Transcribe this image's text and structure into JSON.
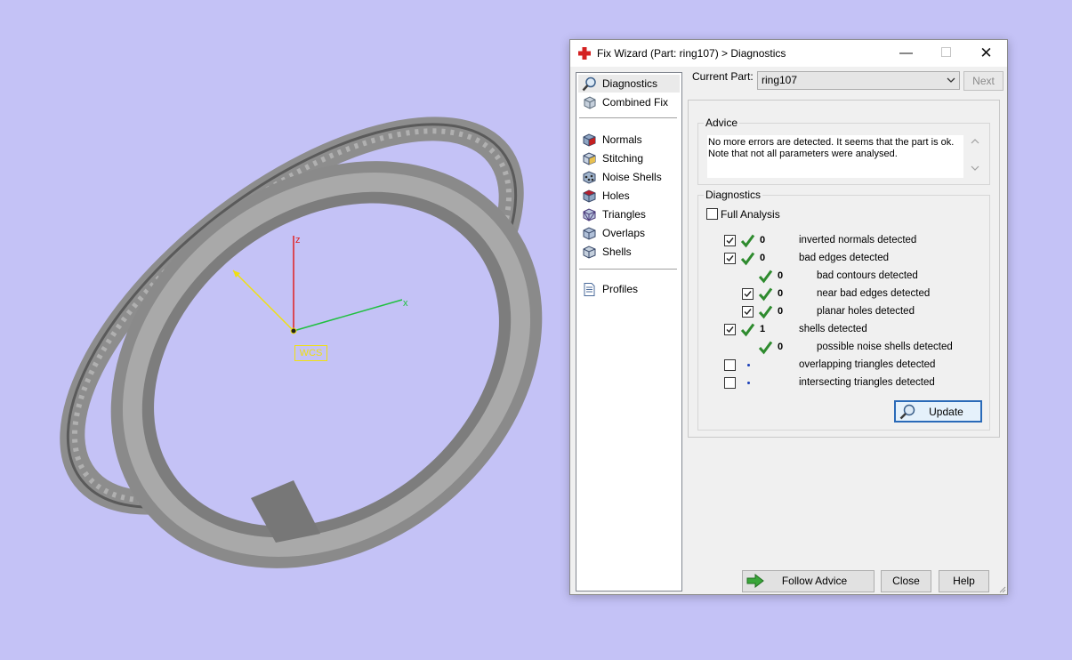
{
  "viewport": {
    "wcs_label": "WCS",
    "axis_z_label": "z",
    "axis_x_label": "x",
    "background_color": "#c4c2f6",
    "part_color": "#8c8c8c"
  },
  "window": {
    "title": "Fix Wizard (Part: ring107) > Diagnostics",
    "minimize_glyph": "—",
    "maximize_glyph": "☐",
    "close_glyph": "✕"
  },
  "nav": {
    "items": [
      {
        "label": "Diagnostics",
        "icon": "magnifier-icon",
        "selected": true
      },
      {
        "label": "Combined Fix",
        "icon": "combined-fix-icon"
      },
      {
        "label": "Normals",
        "icon": "normals-cube-icon"
      },
      {
        "label": "Stitching",
        "icon": "stitching-cube-icon"
      },
      {
        "label": "Noise Shells",
        "icon": "noise-shells-cube-icon"
      },
      {
        "label": "Holes",
        "icon": "holes-cube-icon"
      },
      {
        "label": "Triangles",
        "icon": "triangles-cube-icon"
      },
      {
        "label": "Overlaps",
        "icon": "overlaps-cube-icon"
      },
      {
        "label": "Shells",
        "icon": "shells-cube-icon"
      },
      {
        "label": "Profiles",
        "icon": "profiles-document-icon"
      }
    ]
  },
  "current_part": {
    "label": "Current Part:",
    "value": "ring107",
    "next_label": "Next"
  },
  "advice": {
    "title": "Advice",
    "line1": "No more errors are detected. It seems that the part is ok.",
    "line2": "Note that not all parameters were analysed."
  },
  "diagnostics": {
    "title": "Diagnostics",
    "full_analysis_label": "Full Analysis",
    "full_analysis_checked": false,
    "rows": [
      {
        "label": "inverted normals detected",
        "count": "0",
        "checked": true,
        "status": "ok",
        "indent": 0
      },
      {
        "label": "bad edges detected",
        "count": "0",
        "checked": true,
        "status": "ok",
        "indent": 0
      },
      {
        "label": "bad contours detected",
        "count": "0",
        "status": "ok",
        "indent": 1
      },
      {
        "label": "near bad edges detected",
        "count": "0",
        "checked": true,
        "status": "ok",
        "indent": 1
      },
      {
        "label": "planar holes detected",
        "count": "0",
        "checked": true,
        "status": "ok",
        "indent": 1
      },
      {
        "label": "shells detected",
        "count": "1",
        "checked": true,
        "status": "ok",
        "indent": 0
      },
      {
        "label": "possible noise shells detected",
        "count": "0",
        "status": "ok",
        "indent": 1
      },
      {
        "label": "overlapping triangles detected",
        "count": "",
        "checked": false,
        "status": "pending",
        "indent": 0
      },
      {
        "label": "intersecting triangles detected",
        "count": "",
        "checked": false,
        "status": "pending",
        "indent": 0
      }
    ],
    "update_label": "Update"
  },
  "buttons": {
    "follow_advice": "Follow Advice",
    "close": "Close",
    "help": "Help"
  },
  "colors": {
    "ok_tick": "#2e8b2e",
    "pending_dot": "#1a3fb8",
    "accent_border": "#2a6ab8",
    "follow_arrow": "#3aa63a",
    "app_icon": "#d42020"
  }
}
